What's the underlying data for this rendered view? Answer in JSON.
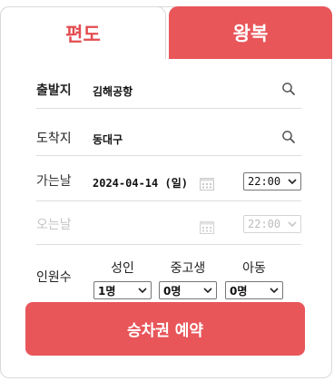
{
  "tabs": {
    "oneway": "편도",
    "roundtrip": "왕복"
  },
  "departure": {
    "label": "출발지",
    "value": "김해공항"
  },
  "arrival": {
    "label": "도착지",
    "value": "동대구"
  },
  "go_date": {
    "label": "가는날",
    "value": "2024-04-14 (일)",
    "time": "22:00"
  },
  "return_date": {
    "label": "오는날",
    "time": "22:00"
  },
  "passengers": {
    "label": "인원수",
    "adult": {
      "label": "성인",
      "value": "1명"
    },
    "youth": {
      "label": "중고생",
      "value": "0명"
    },
    "child": {
      "label": "아동",
      "value": "0명"
    }
  },
  "book_button": "승차권 예약",
  "colors": {
    "accent": "#e8565a",
    "accent_text": "#e34d4f"
  }
}
